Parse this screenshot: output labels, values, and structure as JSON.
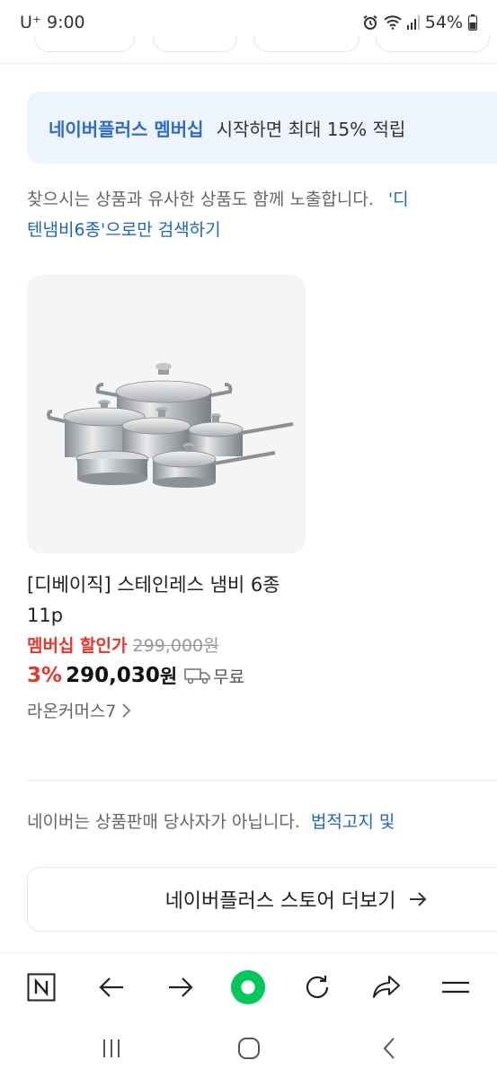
{
  "status_bar": {
    "carrier": "U⁺ 9:00",
    "battery": "54%"
  },
  "membership_banner": {
    "brand": "네이버플러스 멤버십",
    "text": "시작하면 최대 15% 적립"
  },
  "suggestion": {
    "line1_prefix": "찾으시는 상품과 유사한 상품도 함께 노출합니다.",
    "line1_link": "'디",
    "line2_link": "텐냄비6종'으로만 검색하기"
  },
  "product": {
    "title": "[디베이직] 스테인레스 냄비 6종 11p",
    "membership_label": "멤버십 할인가",
    "original_price": "299,000원",
    "discount_rate": "3%",
    "price": "290,030",
    "price_unit": "원",
    "shipping": "무료",
    "seller": "라온커머스7"
  },
  "disclaimer": {
    "text": "네이버는 상품판매 당사자가 아닙니다.",
    "link": "법적고지 및"
  },
  "more_button": {
    "label": "네이버플러스 스토어 더보기"
  },
  "icons": {
    "toolbar": [
      "naver-n-icon",
      "back-arrow-icon",
      "forward-arrow-icon",
      "green-home-icon",
      "refresh-icon",
      "share-icon",
      "menu-icon"
    ],
    "nav": [
      "recent-apps-icon",
      "home-icon",
      "back-icon"
    ]
  },
  "colors": {
    "accent_blue": "#2f6cc5",
    "link_blue": "#1e63c6",
    "sale_red": "#e2372c",
    "naver_green": "#03c75a",
    "banner_bg": "#eef4fd"
  }
}
